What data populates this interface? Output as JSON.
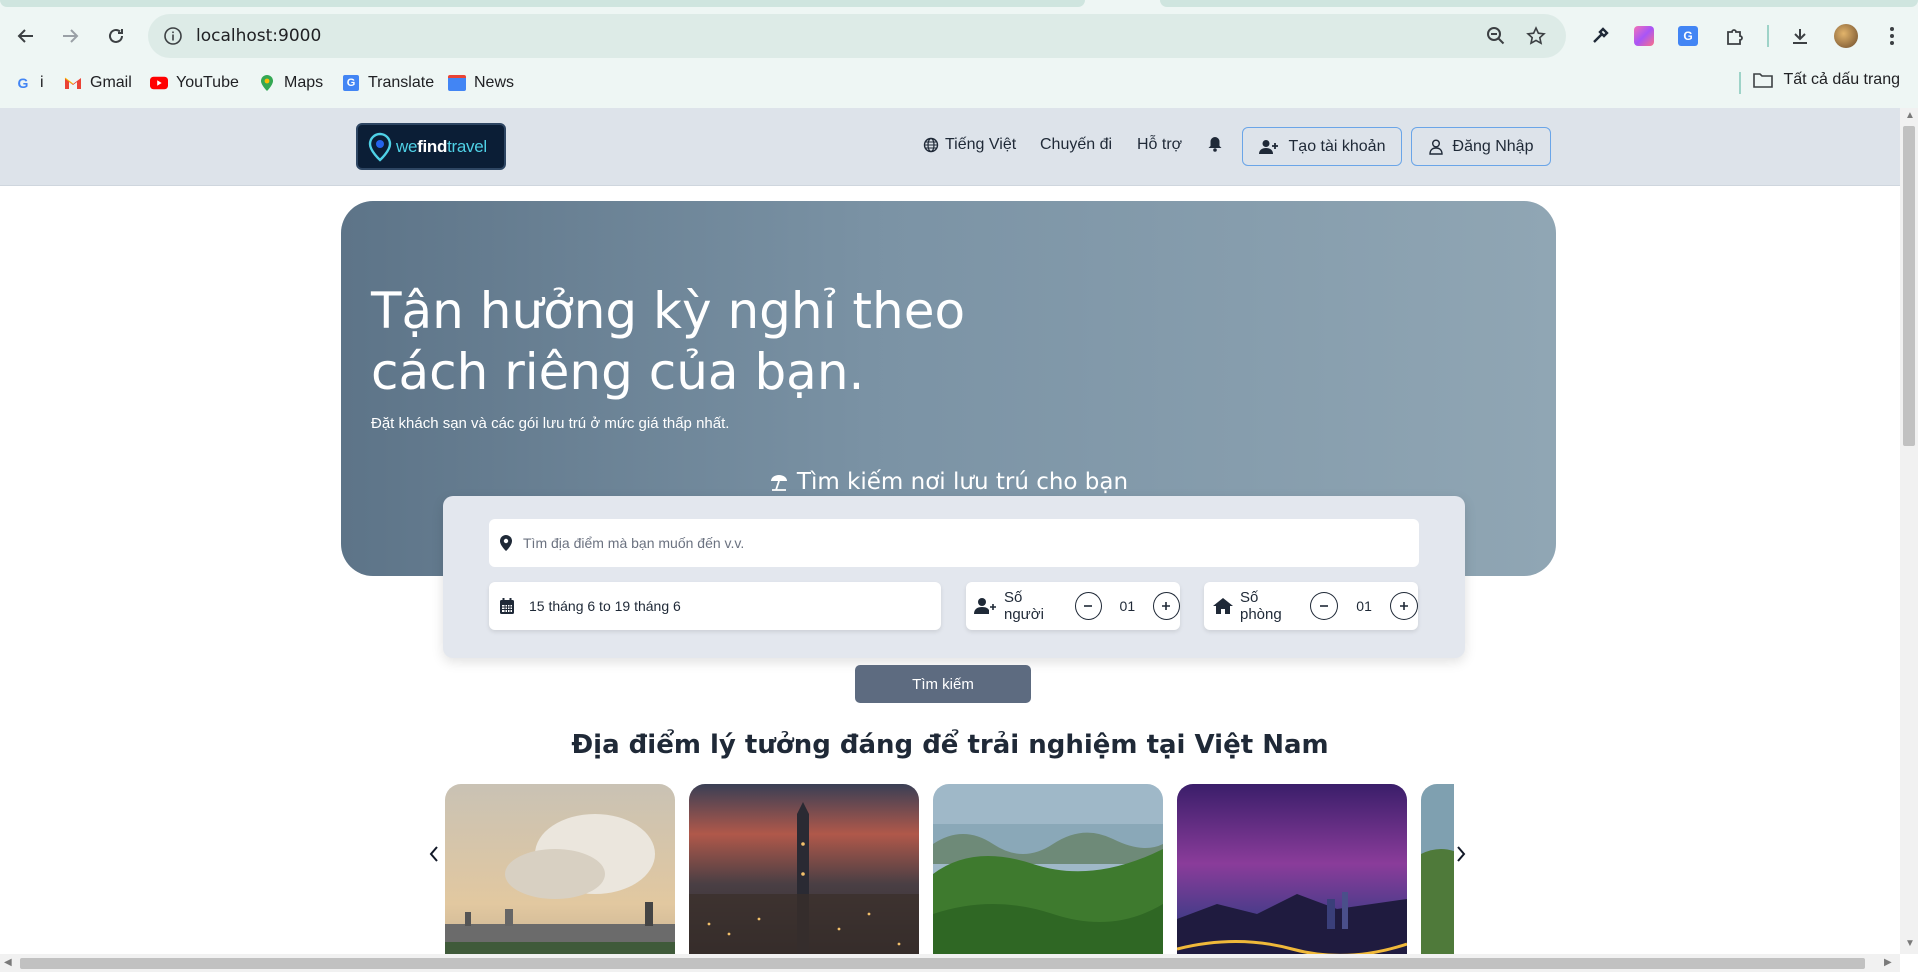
{
  "browser": {
    "url": "localhost:9000",
    "bookmarks": [
      {
        "label": "i",
        "icon": "google-icon"
      },
      {
        "label": "Gmail",
        "icon": "gmail-icon"
      },
      {
        "label": "YouTube",
        "icon": "youtube-icon"
      },
      {
        "label": "Maps",
        "icon": "maps-icon"
      },
      {
        "label": "Translate",
        "icon": "translate-icon"
      },
      {
        "label": "News",
        "icon": "news-icon"
      }
    ],
    "all_bookmarks": "Tất cả dấu trang"
  },
  "header": {
    "logo": {
      "prefix": "we",
      "bold": "find",
      "suffix": "travel"
    },
    "language": "Tiếng Việt",
    "trips": "Chuyến đi",
    "support": "Hỗ trợ",
    "register": "Tạo tài khoản",
    "login": "Đăng Nhập"
  },
  "hero": {
    "title_line1": "Tận hưởng kỳ nghỉ theo",
    "title_line2": "cách riêng của bạn.",
    "subtitle": "Đặt khách sạn và các gói lưu trú ở mức giá thấp nhất.",
    "search_title": "Tìm kiếm nơi lưu trú cho bạn"
  },
  "search": {
    "destination_placeholder": "Tìm địa điểm mà bạn muốn đến v.v.",
    "dates": "15 tháng 6 to 19 tháng 6",
    "guests_label": "Số người",
    "guests_value": "01",
    "rooms_label": "Số phòng",
    "rooms_value": "01",
    "button": "Tìm kiếm"
  },
  "destinations": {
    "title": "Địa điểm lý tưởng đáng để trải nghiệm tại Việt Nam"
  },
  "colors": {
    "header_bg": "#dde3ea",
    "button_border": "#6aa5e8",
    "search_button": "#5d6b80"
  }
}
